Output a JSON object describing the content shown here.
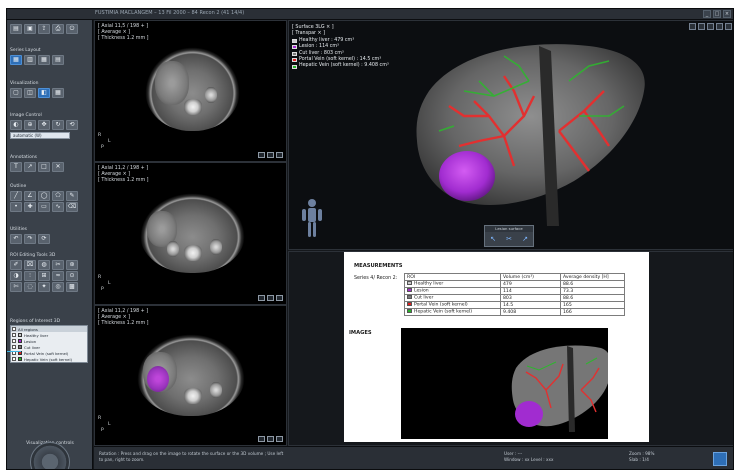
{
  "window": {
    "title": "FUSTIMIA MACLANGEM – 13 Fil 2000 – 84 Recon 2 (41 14/4)",
    "buttons": [
      "_",
      "□",
      "×"
    ]
  },
  "toolbar": {
    "sections": [
      {
        "label": "Series Layout"
      },
      {
        "label": "Visualization"
      },
      {
        "label": "Image Control"
      },
      {
        "label": "Annotations"
      },
      {
        "label": "Outline"
      },
      {
        "label": "Utilities"
      },
      {
        "label": "ROI Editing Tools 3D"
      },
      {
        "label": "Regions of Interest 3D"
      }
    ],
    "select_value": "automatic (W)",
    "roi_list": {
      "header": "All regions",
      "items": [
        {
          "label": "Healthy liver",
          "color": "#c9c9c9"
        },
        {
          "label": "Lesion",
          "color": "#a52ad0"
        },
        {
          "label": "Cut liver",
          "color": "#7a7a7a"
        },
        {
          "label": "Portal Vein (soft kernel)",
          "color": "#e02020"
        },
        {
          "label": "Hepatic Vein (soft kernel)",
          "color": "#27b227"
        }
      ]
    },
    "nav_label": "Visualization controls"
  },
  "panels2d": [
    {
      "line1": "[ Axial 11,5 / 198 + ]",
      "line2": "[ Average × ]",
      "line3": "[ Thickness 1.2 mm ]",
      "right": "R",
      "left": "L",
      "posterior": "P"
    },
    {
      "line1": "[ Axial 11,2 / 198 + ]",
      "line2": "[ Average × ]",
      "line3": "[ Thickness 1.2 mm ]",
      "right": "R",
      "left": "L",
      "posterior": "P"
    },
    {
      "line1": "[ Axial 11,2 / 198 + ]",
      "line2": "[ Average × ]",
      "line3": "[ Thickness 1.2 mm ]",
      "right": "R",
      "left": "L",
      "posterior": "P"
    }
  ],
  "view3d": {
    "header1": "[ Surface 3LG × ]",
    "header2": "[ Transpar × ]",
    "legend": [
      {
        "label": "Healthy liver : 479 cm³",
        "color": "#c9c9c9"
      },
      {
        "label": "Lesion : 114 cm³",
        "color": "#a52ad0"
      },
      {
        "label": "Cut liver : 803 cm³",
        "color": "#7a7a7a"
      },
      {
        "label": "Portal Vein (soft kernel) : 14.5 cm³",
        "color": "#e02020"
      },
      {
        "label": "Hepatic Vein (soft kernel) : 9.408 cm³",
        "color": "#27b227"
      }
    ],
    "toolbox_title": "Lesion surface"
  },
  "report": {
    "title": "MEASUREMENTS",
    "series_label": "Series 4/ Recon 2:",
    "headers": {
      "roi": "ROI",
      "volume": "Volume (cm³)",
      "density": "Average density [H]"
    },
    "rows": [
      {
        "roi": "Healthy liver",
        "volume": "479",
        "density": "88.6",
        "color": "#c9c9c9"
      },
      {
        "roi": "Lesion",
        "volume": "114",
        "density": "73.3",
        "color": "#a52ad0"
      },
      {
        "roi": "Cut liver",
        "volume": "803",
        "density": "88.6",
        "color": "#7a7a7a"
      },
      {
        "roi": "Portal Vein (soft kernel)",
        "volume": "14.5",
        "density": "165",
        "color": "#e02020"
      },
      {
        "roi": "Hepatic Vein (soft kernel)",
        "volume": "9.408",
        "density": "166",
        "color": "#27b227"
      }
    ],
    "images_title": "IMAGES"
  },
  "status": {
    "hint_line1": "Rotation : Press and drag on the image to rotate the surface or the 3D volume ; Use left",
    "hint_line2": "to pan, right to zoom.",
    "user_line1": "User : ---",
    "user_line2": "Window : xx   Level : xxx",
    "zoom_line1": "Zoom : 98%",
    "zoom_line2": "Slab : 1/4"
  },
  "colors": {
    "accent": "#2e6fb7",
    "lesion": "#a52ad0",
    "portal_vein": "#e02020",
    "hepatic_vein": "#27b227",
    "background": "#15181c"
  }
}
